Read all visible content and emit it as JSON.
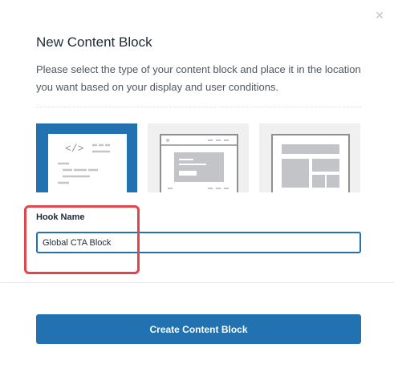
{
  "modal": {
    "close_icon": "close-icon",
    "title": "New Content Block",
    "description": "Please select the type of your content block and place it in the location you want based on your display and user conditions."
  },
  "block_types": [
    {
      "icon": "code-block-icon",
      "selected": true
    },
    {
      "icon": "popup-block-icon",
      "selected": false
    },
    {
      "icon": "page-layout-block-icon",
      "selected": false
    }
  ],
  "hook_name": {
    "label": "Hook Name",
    "value": "Global CTA Block"
  },
  "create_button": {
    "label": "Create Content Block"
  },
  "colors": {
    "accent": "#2271b1",
    "highlight": "#e0474c"
  }
}
